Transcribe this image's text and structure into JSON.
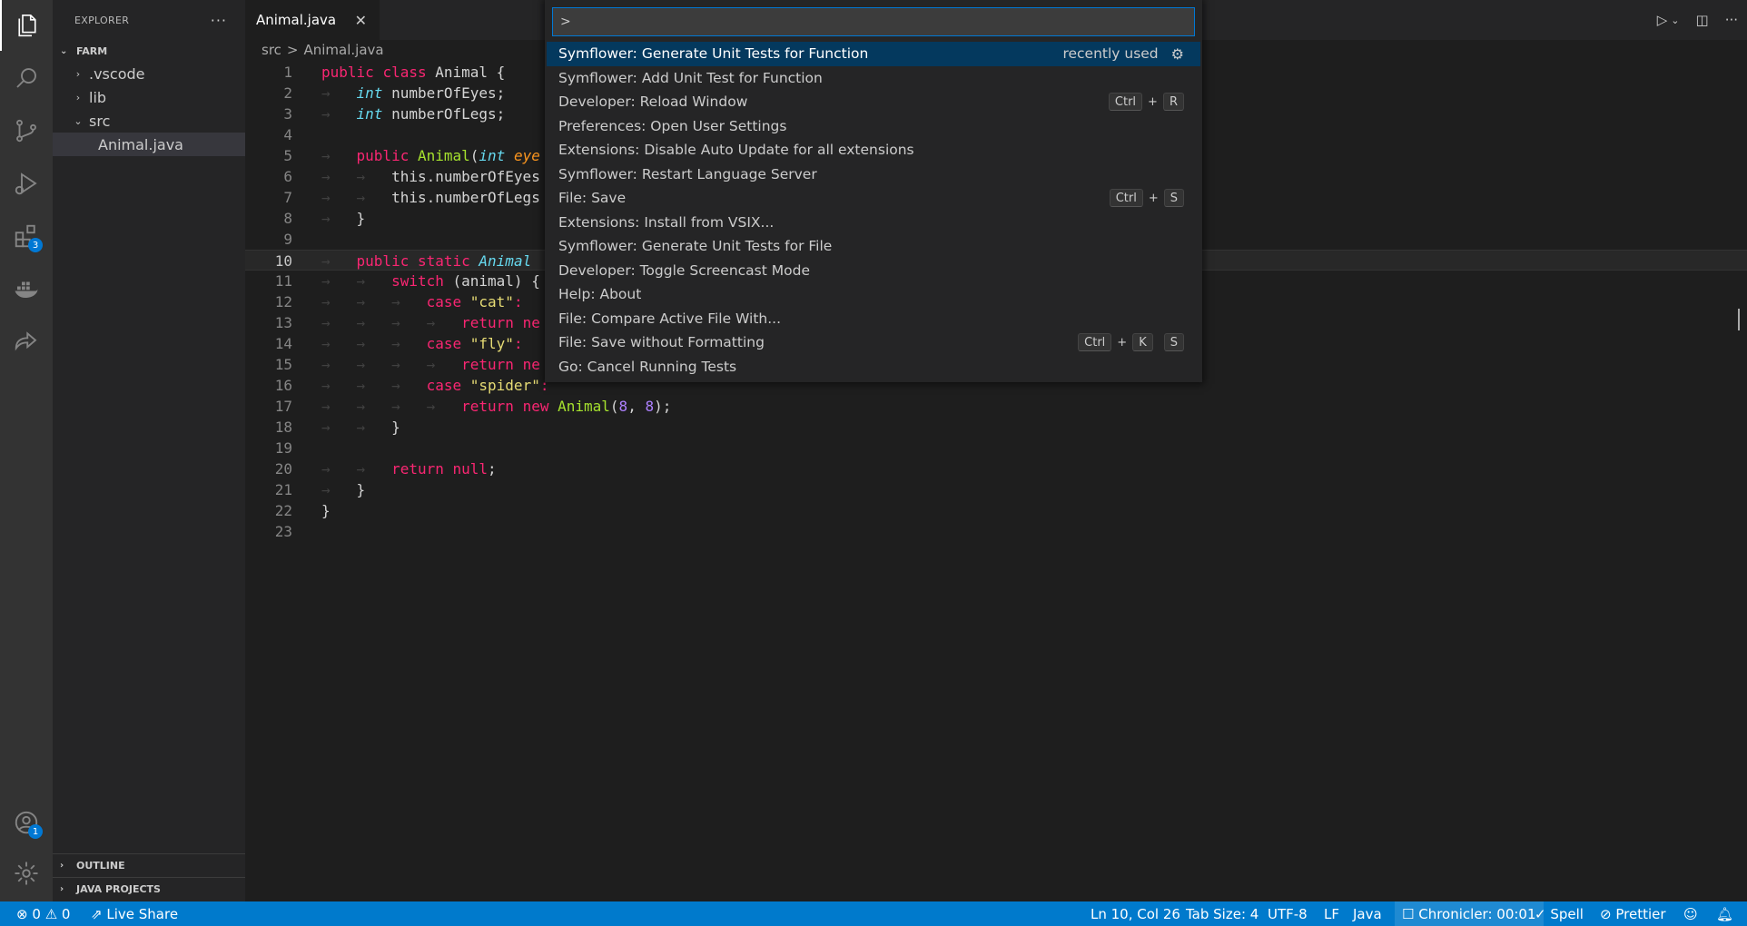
{
  "activity_bar": {
    "extensions_badge": "3",
    "accounts_badge": "1",
    "icons": [
      "explorer-icon",
      "search-icon",
      "source-control-icon",
      "run-debug-icon",
      "extensions-icon",
      "docker-icon",
      "live-share-icon",
      "accounts-icon",
      "manage-gear-icon"
    ]
  },
  "sidebar": {
    "title": "EXPLORER",
    "more": "···",
    "folder": "FARM",
    "tree": [
      {
        "label": ".vscode",
        "chevron": "›"
      },
      {
        "label": "lib",
        "chevron": "›"
      },
      {
        "label": "src",
        "chevron": "⌄"
      },
      {
        "label": "Animal.java",
        "chevron": ""
      }
    ],
    "outline": "OUTLINE",
    "java_projects": "JAVA PROJECTS"
  },
  "tab": {
    "label": "Animal.java",
    "close": "✕"
  },
  "breadcrumb": {
    "folder": "src",
    "sep": ">",
    "file": "Animal.java"
  },
  "editor": {
    "line_numbers": [
      "1",
      "2",
      "3",
      "4",
      "5",
      "6",
      "7",
      "8",
      "9",
      "10",
      "11",
      "12",
      "13",
      "14",
      "15",
      "16",
      "17",
      "18",
      "19",
      "20",
      "21",
      "22",
      "23"
    ],
    "current_line": 10
  },
  "palette": {
    "input": ">",
    "commands": [
      {
        "label": "Symflower: Generate Unit Tests for Function",
        "hint": "recently used"
      },
      {
        "label": "Symflower: Add Unit Test for Function"
      },
      {
        "label": "Developer: Reload Window",
        "keys": [
          "Ctrl",
          "+",
          "R"
        ]
      },
      {
        "label": "Preferences: Open User Settings"
      },
      {
        "label": "Extensions: Disable Auto Update for all extensions"
      },
      {
        "label": "Symflower: Restart Language Server"
      },
      {
        "label": "File: Save",
        "keys": [
          "Ctrl",
          "+",
          "S"
        ]
      },
      {
        "label": "Extensions: Install from VSIX..."
      },
      {
        "label": "Symflower: Generate Unit Tests for File"
      },
      {
        "label": "Developer: Toggle Screencast Mode"
      },
      {
        "label": "Help: About"
      },
      {
        "label": "File: Compare Active File With..."
      },
      {
        "label": "File: Save without Formatting",
        "keys": [
          "Ctrl",
          "+",
          "K",
          "S"
        ]
      },
      {
        "label": "Go: Cancel Running Tests"
      }
    ]
  },
  "status_bar": {
    "errors": "0",
    "warnings": "0",
    "live_share": "Live Share",
    "position": "Ln 10, Col 26",
    "tab_size": "Tab Size: 4",
    "encoding": "UTF-8",
    "eol": "LF",
    "language": "Java",
    "chronicler": "Chronicler: 00:01",
    "spell": "Spell",
    "prettier": "Prettier"
  },
  "colors": {
    "accent": "#007acc",
    "selection": "#04395e",
    "keyword": "#f92672",
    "type": "#66d9ef",
    "class": "#a6e22e",
    "string": "#e6db74",
    "number": "#ae81ff"
  }
}
